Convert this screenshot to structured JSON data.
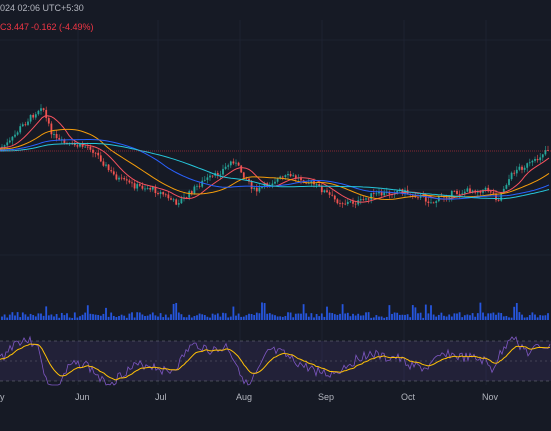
{
  "header": {
    "timestamp_text": "024 02:06 UTC+5:30",
    "price_text": "C3.447",
    "change_text": "-0.162 (-4.49%)"
  },
  "colors": {
    "background": "#161a25",
    "candle_up": "#26a69a",
    "candle_down": "#ef5350",
    "ma_fast": "#f7525f",
    "ma_mid": "#f59d0b",
    "ma_slow": "#2962ff",
    "ma_long": "#26c6da",
    "volume": "#2962ff",
    "rsi_line": "#7e57c2",
    "rsi_ma": "#ffc107",
    "grid": "#23283a",
    "text": "#b2b5be"
  },
  "time_axis": {
    "labels": [
      "y",
      "Jun",
      "Jul",
      "Aug",
      "Sep",
      "Oct",
      "Nov"
    ]
  },
  "panes": [
    "price",
    "volume",
    "rsi"
  ]
}
